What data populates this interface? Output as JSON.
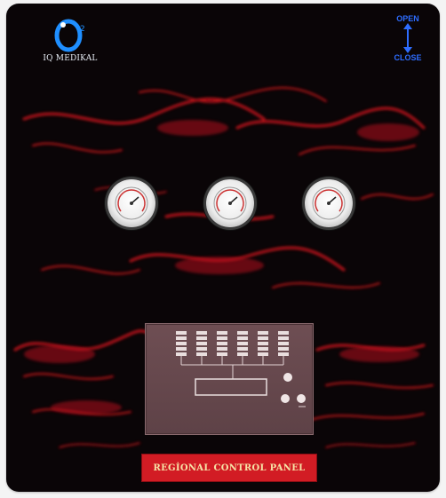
{
  "brand": {
    "name": "IQ MEDIKAL",
    "logo_icon": "o2-logo-icon"
  },
  "valve": {
    "open_label": "OPEN",
    "close_label": "CLOSE",
    "accent": "#2e6dff"
  },
  "gauges": [
    {
      "name": "pressure-gauge-left"
    },
    {
      "name": "pressure-gauge-center"
    },
    {
      "name": "pressure-gauge-right"
    }
  ],
  "panel": {
    "label": "REGİONAL CONTROL PANEL",
    "label_bg": "#d21c24",
    "label_text": "#f6e2a6"
  }
}
